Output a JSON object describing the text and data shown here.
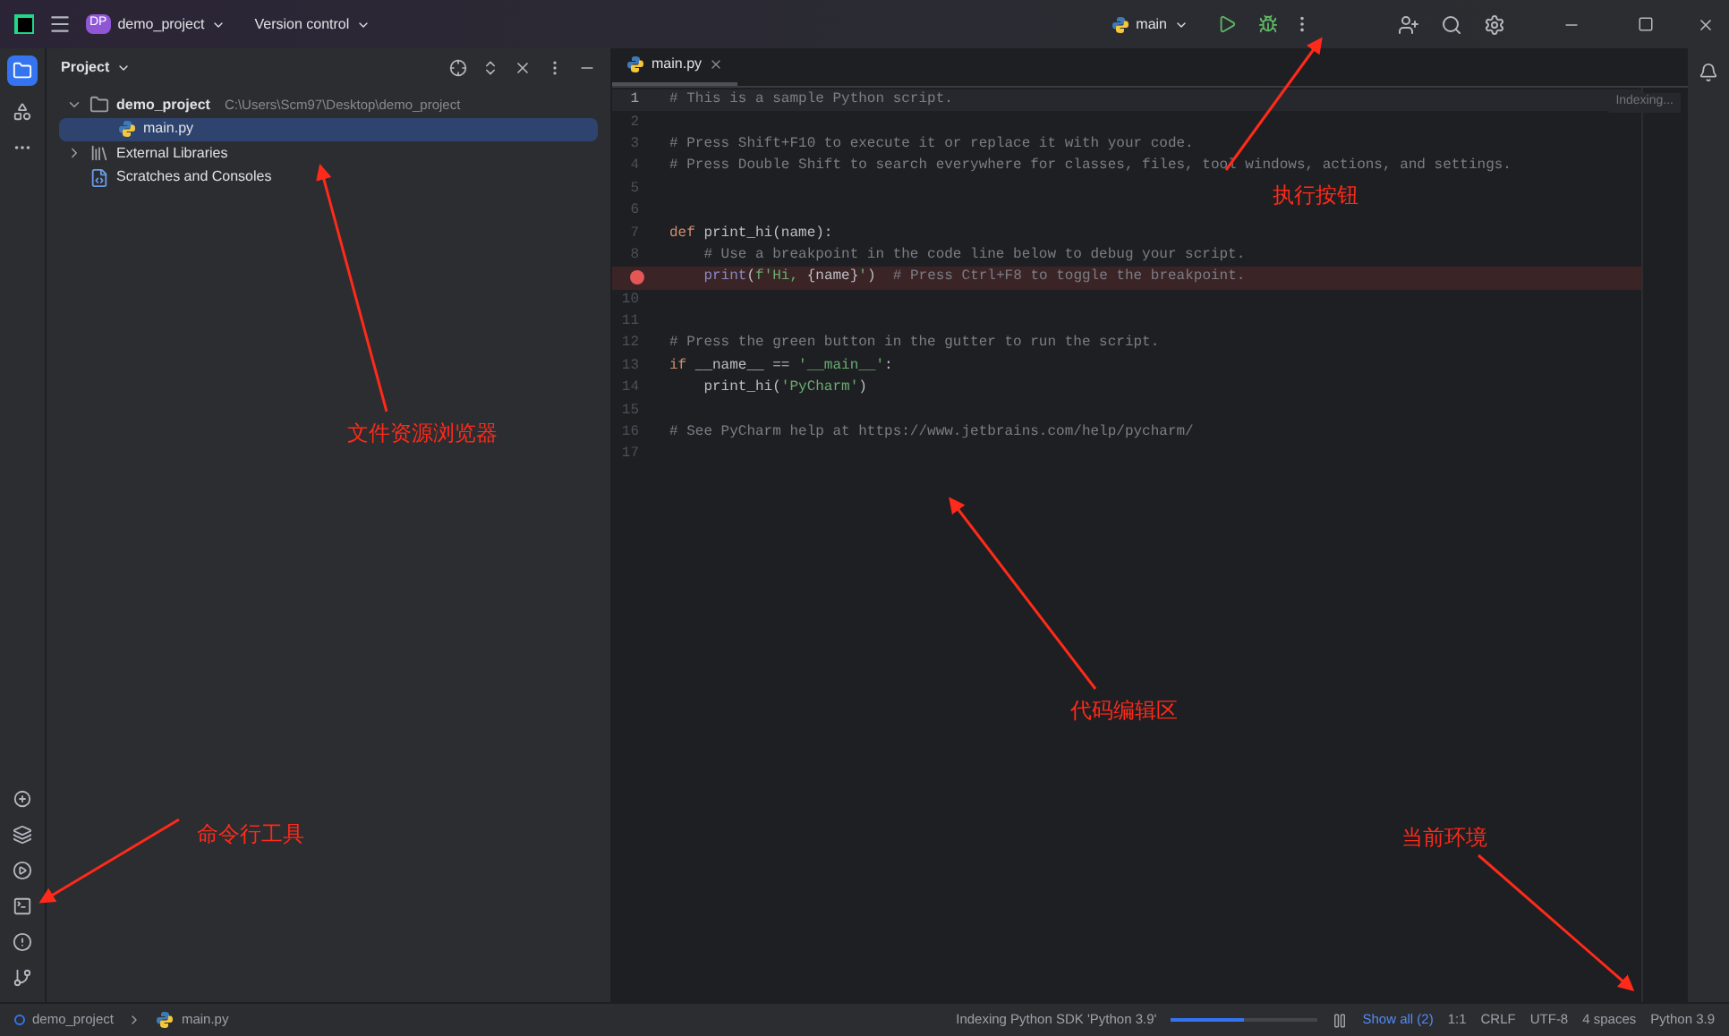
{
  "title_bar": {
    "project_badge": "DP",
    "project": "demo_project",
    "vcs": "Version control",
    "run_config": "main"
  },
  "project_panel": {
    "title": "Project",
    "tree": [
      {
        "label": "demo_project",
        "path": "C:\\Users\\Scm97\\Desktop\\demo_project",
        "kind": "folder",
        "expanded": true,
        "selected": false,
        "children": [
          {
            "label": "main.py",
            "kind": "python",
            "selected": true
          }
        ]
      },
      {
        "label": "External Libraries",
        "kind": "library",
        "expanded": false,
        "selected": false
      },
      {
        "label": "Scratches and Consoles",
        "kind": "scratch",
        "selected": false
      }
    ]
  },
  "editor": {
    "tab": "main.py",
    "indexing": "Indexing...",
    "lines": [
      {
        "number": "1",
        "current": true,
        "breakpoint": false,
        "tokens": [
          {
            "kind": "comment",
            "text": "# This is a sample Python script."
          }
        ]
      },
      {
        "number": "2",
        "current": false,
        "breakpoint": false
      },
      {
        "number": "3",
        "current": false,
        "breakpoint": false,
        "tokens": [
          {
            "kind": "comment",
            "text": "# Press Shift+F10 to execute it or replace it with your code."
          }
        ]
      },
      {
        "number": "4",
        "current": false,
        "breakpoint": false,
        "tokens": [
          {
            "kind": "comment",
            "text": "# Press Double Shift to search everywhere for classes, files, tool windows, actions, and settings."
          }
        ]
      },
      {
        "number": "5",
        "current": false,
        "breakpoint": false
      },
      {
        "number": "6",
        "current": false,
        "breakpoint": false
      },
      {
        "number": "7",
        "current": false,
        "breakpoint": false,
        "tokens": [
          {
            "kind": "keyword",
            "text": "def "
          },
          {
            "kind": "plain",
            "text": "print_hi(name):"
          }
        ]
      },
      {
        "number": "8",
        "current": false,
        "breakpoint": false,
        "tokens": [
          {
            "kind": "comment",
            "text": "    # Use a breakpoint in the code line below to debug your script."
          }
        ]
      },
      {
        "current": false,
        "breakpoint": true,
        "tokens": [
          {
            "kind": "builtin",
            "text": "    print"
          },
          {
            "kind": "plain",
            "text": "("
          },
          {
            "kind": "string",
            "text": "f'Hi, "
          },
          {
            "kind": "plain",
            "text": "{name}"
          },
          {
            "kind": "string",
            "text": "'"
          },
          {
            "kind": "plain",
            "text": ")  "
          },
          {
            "kind": "comment",
            "text": "# Press Ctrl+F8 to toggle the breakpoint."
          }
        ]
      },
      {
        "number": "10",
        "current": false,
        "breakpoint": false
      },
      {
        "number": "11",
        "current": false,
        "breakpoint": false
      },
      {
        "number": "12",
        "current": false,
        "breakpoint": false,
        "tokens": [
          {
            "kind": "comment",
            "text": "# Press the green button in the gutter to run the script."
          }
        ]
      },
      {
        "number": "13",
        "current": false,
        "breakpoint": false,
        "tokens": [
          {
            "kind": "keyword",
            "text": "if "
          },
          {
            "kind": "plain",
            "text": "__name__ == "
          },
          {
            "kind": "string",
            "text": "'__main__'"
          },
          {
            "kind": "plain",
            "text": ":"
          }
        ]
      },
      {
        "number": "14",
        "current": false,
        "breakpoint": false,
        "tokens": [
          {
            "kind": "plain",
            "text": "    print_hi("
          },
          {
            "kind": "string",
            "text": "'PyCharm'"
          },
          {
            "kind": "plain",
            "text": ")"
          }
        ]
      },
      {
        "number": "15",
        "current": false,
        "breakpoint": false
      },
      {
        "number": "16",
        "current": false,
        "breakpoint": false,
        "tokens": [
          {
            "kind": "comment",
            "text": "# See PyCharm help at https://www.jetbrains.com/help/pycharm/"
          }
        ]
      },
      {
        "number": "17",
        "current": false,
        "breakpoint": false
      }
    ]
  },
  "status_bar": {
    "breadcrumbs": [
      "demo_project",
      "main.py"
    ],
    "task": "Indexing Python SDK 'Python 3.9'",
    "progress": {
      "level": 0.5
    },
    "show_all": "Show all (2)",
    "items": [
      "1:1",
      "CRLF",
      "UTF-8",
      "4 spaces",
      "Python 3.9"
    ]
  },
  "annotations": [
    {
      "text": "执行按钮"
    },
    {
      "text": "文件资源浏览器"
    },
    {
      "text": "代码编辑区"
    },
    {
      "text": "命令行工具"
    },
    {
      "text": "当前环境"
    }
  ]
}
